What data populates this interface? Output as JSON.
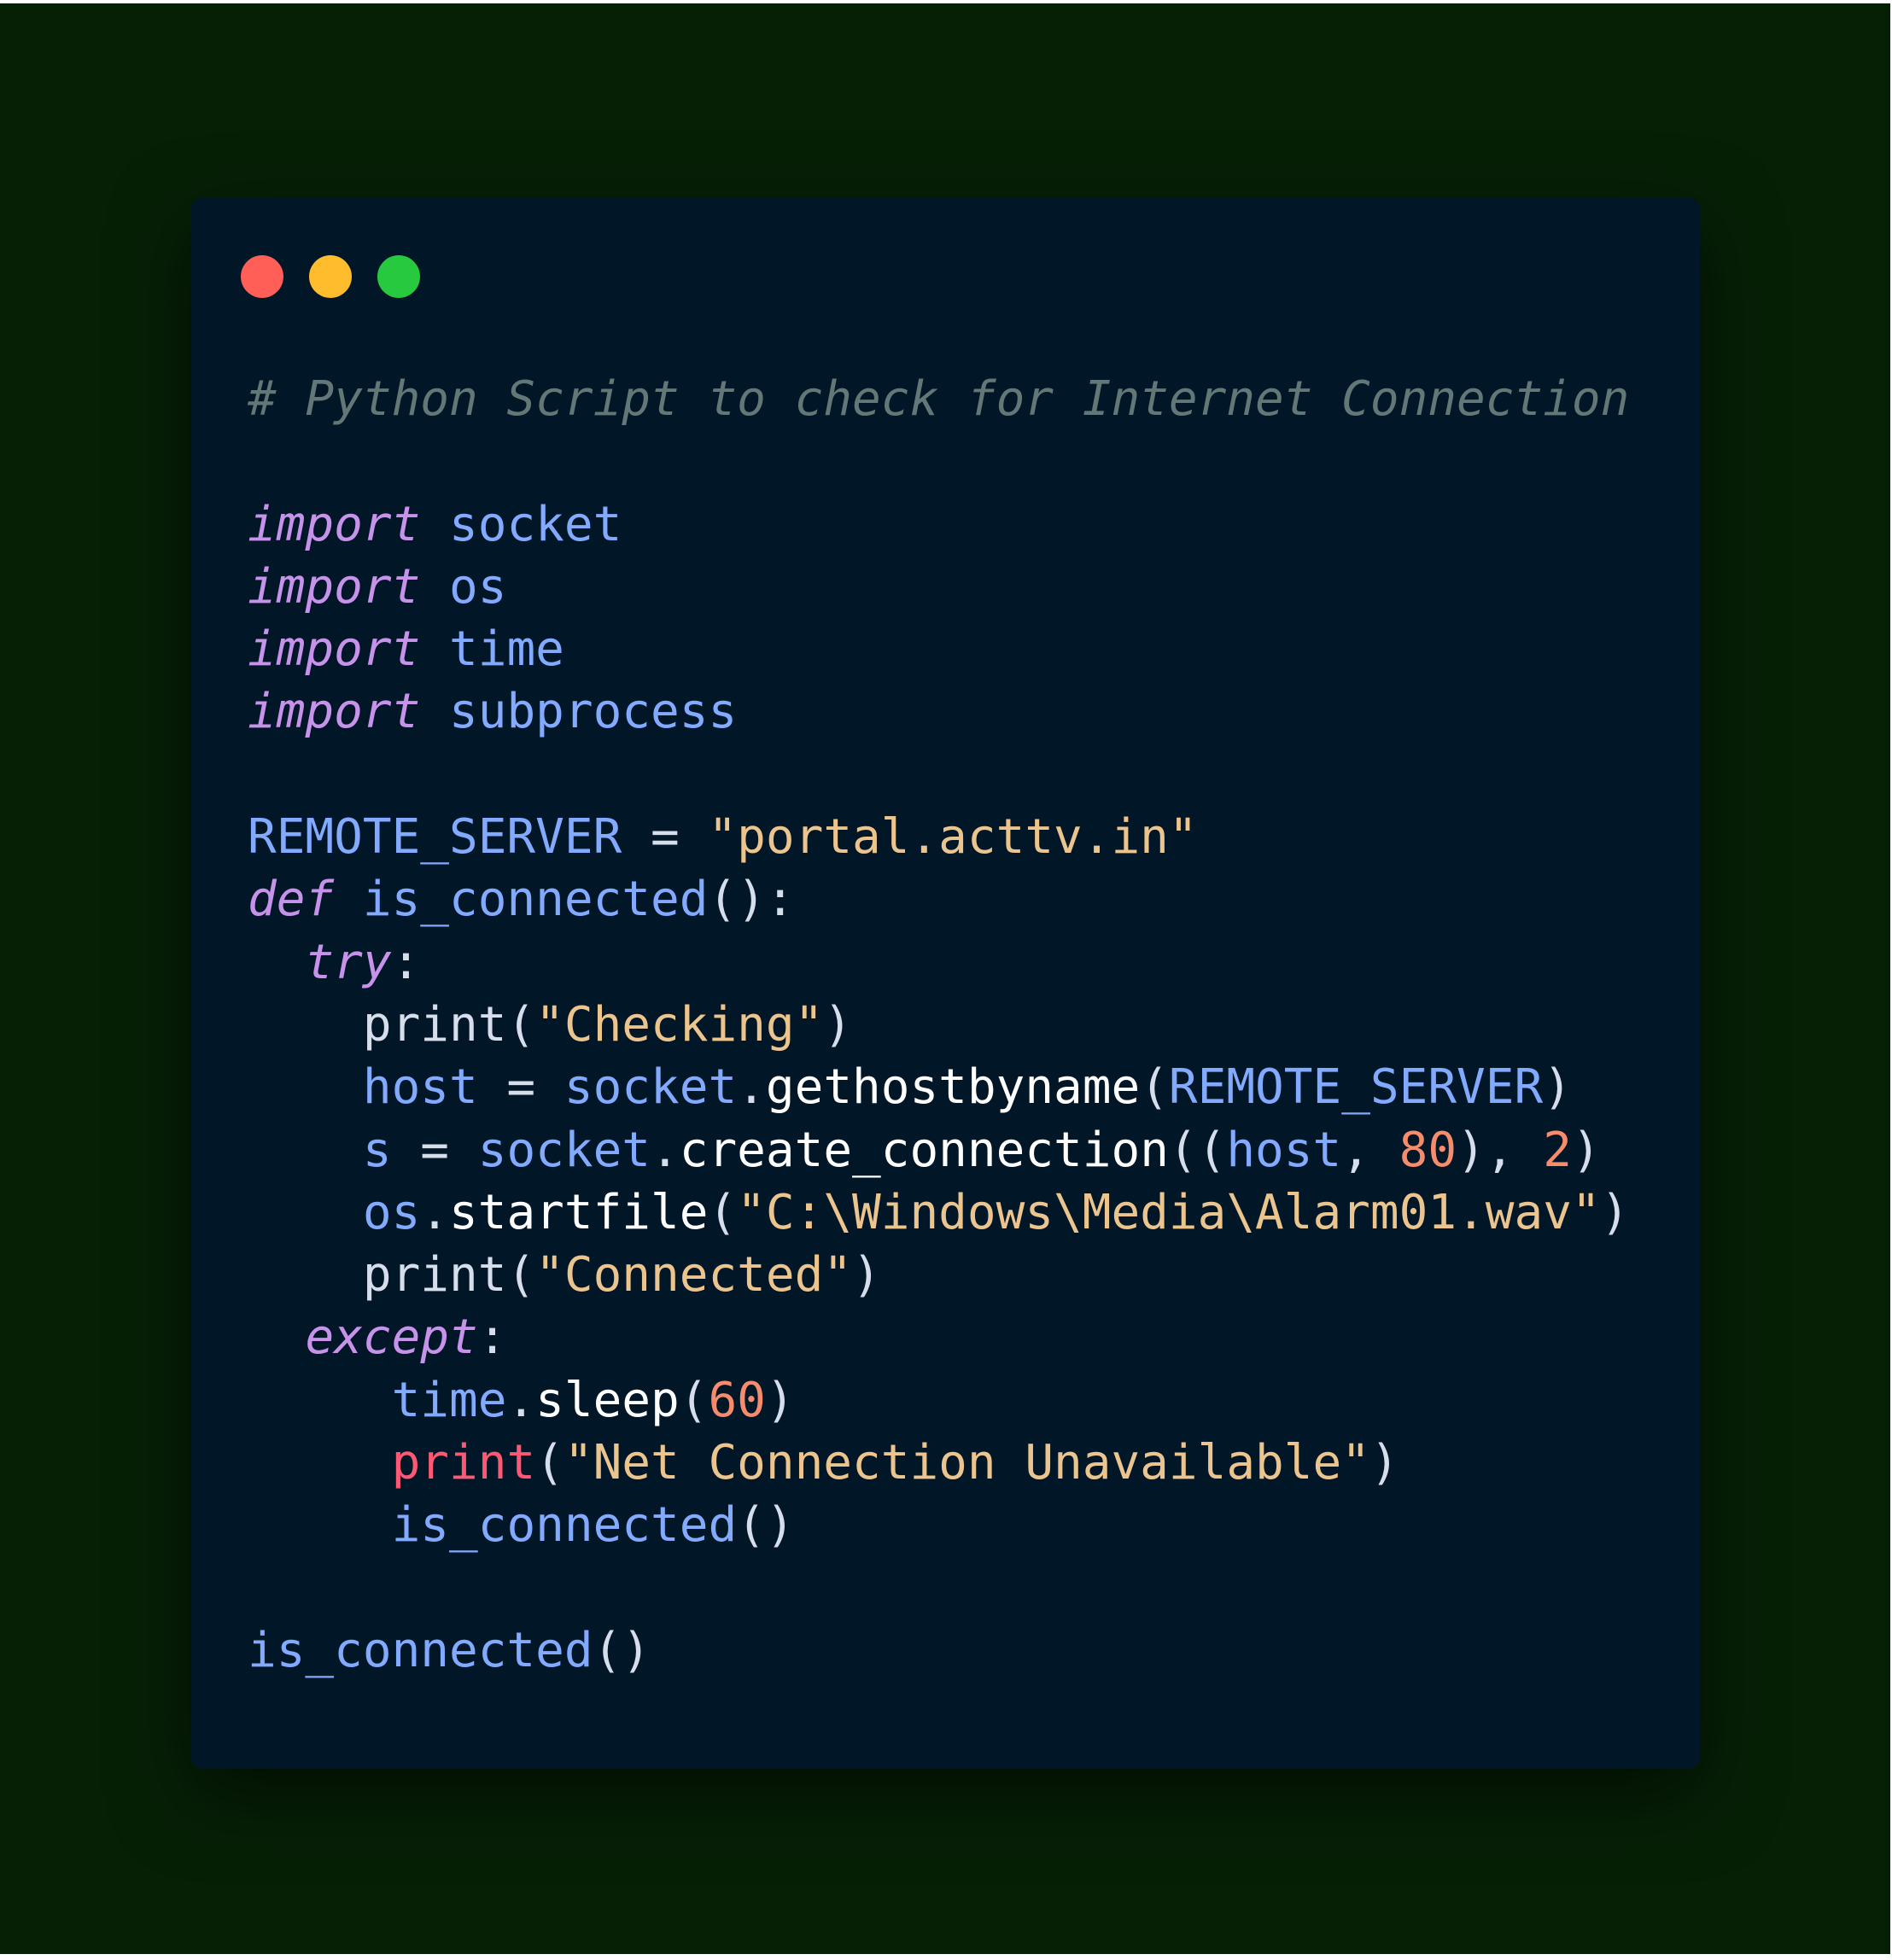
{
  "window_controls": {
    "close_color": "#ff5f56",
    "minimize_color": "#ffbd2e",
    "maximize_color": "#27c93f"
  },
  "code": {
    "language": "python",
    "theme_colors": {
      "background": "#011627",
      "outer_background": "#062006",
      "comment": "#637777",
      "keyword": "#c792ea",
      "identifier": "#82aaff",
      "string": "#ecc48d",
      "number": "#f78c6c"
    },
    "lines": [
      [
        {
          "t": "comment",
          "v": "# Python Script to check for Internet Connection"
        }
      ],
      [],
      [
        {
          "t": "kw",
          "v": "import"
        },
        {
          "t": "punc",
          "v": " "
        },
        {
          "t": "id",
          "v": "socket"
        }
      ],
      [
        {
          "t": "kw",
          "v": "import"
        },
        {
          "t": "punc",
          "v": " "
        },
        {
          "t": "id",
          "v": "os"
        }
      ],
      [
        {
          "t": "kw",
          "v": "import"
        },
        {
          "t": "punc",
          "v": " "
        },
        {
          "t": "id",
          "v": "time"
        }
      ],
      [
        {
          "t": "kw",
          "v": "import"
        },
        {
          "t": "punc",
          "v": " "
        },
        {
          "t": "id",
          "v": "subprocess"
        }
      ],
      [],
      [
        {
          "t": "id",
          "v": "REMOTE_SERVER"
        },
        {
          "t": "punc",
          "v": " = "
        },
        {
          "t": "str",
          "v": "\"portal.acttv.in\""
        }
      ],
      [
        {
          "t": "kw",
          "v": "def"
        },
        {
          "t": "punc",
          "v": " "
        },
        {
          "t": "id",
          "v": "is_connected"
        },
        {
          "t": "punc",
          "v": "():"
        }
      ],
      [
        {
          "t": "punc",
          "v": "  "
        },
        {
          "t": "kw",
          "v": "try"
        },
        {
          "t": "punc",
          "v": ":"
        }
      ],
      [
        {
          "t": "punc",
          "v": "    "
        },
        {
          "t": "builtin",
          "v": "print"
        },
        {
          "t": "punc",
          "v": "("
        },
        {
          "t": "str",
          "v": "\"Checking\""
        },
        {
          "t": "punc",
          "v": ")"
        }
      ],
      [
        {
          "t": "punc",
          "v": "    "
        },
        {
          "t": "id",
          "v": "host"
        },
        {
          "t": "punc",
          "v": " = "
        },
        {
          "t": "id",
          "v": "socket"
        },
        {
          "t": "punc",
          "v": "."
        },
        {
          "t": "fn",
          "v": "gethostbyname"
        },
        {
          "t": "punc",
          "v": "("
        },
        {
          "t": "id",
          "v": "REMOTE_SERVER"
        },
        {
          "t": "punc",
          "v": ")"
        }
      ],
      [
        {
          "t": "punc",
          "v": "    "
        },
        {
          "t": "id",
          "v": "s"
        },
        {
          "t": "punc",
          "v": " = "
        },
        {
          "t": "id",
          "v": "socket"
        },
        {
          "t": "punc",
          "v": "."
        },
        {
          "t": "fn",
          "v": "create_connection"
        },
        {
          "t": "punc",
          "v": "(("
        },
        {
          "t": "id",
          "v": "host"
        },
        {
          "t": "punc",
          "v": ", "
        },
        {
          "t": "num",
          "v": "80"
        },
        {
          "t": "punc",
          "v": "), "
        },
        {
          "t": "num",
          "v": "2"
        },
        {
          "t": "punc",
          "v": ")"
        }
      ],
      [
        {
          "t": "punc",
          "v": "    "
        },
        {
          "t": "id",
          "v": "os"
        },
        {
          "t": "punc",
          "v": "."
        },
        {
          "t": "fn",
          "v": "startfile"
        },
        {
          "t": "punc",
          "v": "("
        },
        {
          "t": "str",
          "v": "\"C:\\Windows\\Media\\Alarm01.wav\""
        },
        {
          "t": "punc",
          "v": ")"
        }
      ],
      [
        {
          "t": "punc",
          "v": "    "
        },
        {
          "t": "builtin",
          "v": "print"
        },
        {
          "t": "punc",
          "v": "("
        },
        {
          "t": "str",
          "v": "\"Connected\""
        },
        {
          "t": "punc",
          "v": ")"
        }
      ],
      [
        {
          "t": "punc",
          "v": "  "
        },
        {
          "t": "kw",
          "v": "except"
        },
        {
          "t": "punc",
          "v": ":"
        }
      ],
      [
        {
          "t": "punc",
          "v": "     "
        },
        {
          "t": "id",
          "v": "time"
        },
        {
          "t": "punc",
          "v": "."
        },
        {
          "t": "fn",
          "v": "sleep"
        },
        {
          "t": "punc",
          "v": "("
        },
        {
          "t": "num",
          "v": "60"
        },
        {
          "t": "punc",
          "v": ")"
        }
      ],
      [
        {
          "t": "punc",
          "v": "     "
        },
        {
          "t": "builtin-red",
          "v": "print"
        },
        {
          "t": "punc",
          "v": "("
        },
        {
          "t": "str",
          "v": "\"Net Connection Unavailable\""
        },
        {
          "t": "punc",
          "v": ")"
        }
      ],
      [
        {
          "t": "punc",
          "v": "     "
        },
        {
          "t": "id",
          "v": "is_connected"
        },
        {
          "t": "punc",
          "v": "()"
        }
      ],
      [],
      [
        {
          "t": "id",
          "v": "is_connected"
        },
        {
          "t": "punc",
          "v": "()"
        }
      ]
    ]
  }
}
